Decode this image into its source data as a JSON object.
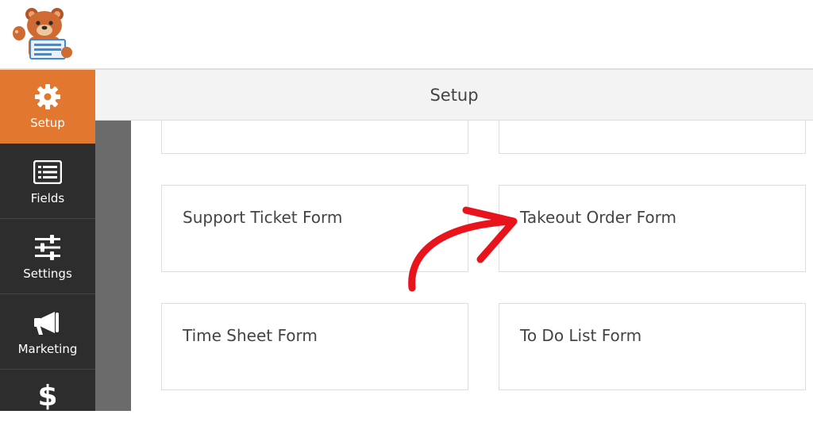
{
  "header": {
    "logo_icon": "wpforms-bear-mascot-icon",
    "setup_title": "Setup"
  },
  "sidebar": {
    "items": [
      {
        "label": "Setup",
        "icon": "gear-icon",
        "active": true
      },
      {
        "label": "Fields",
        "icon": "fields-list-icon",
        "active": false
      },
      {
        "label": "Settings",
        "icon": "sliders-icon",
        "active": false
      },
      {
        "label": "Marketing",
        "icon": "megaphone-icon",
        "active": false
      },
      {
        "label": "",
        "icon": "dollar-icon",
        "active": false
      }
    ]
  },
  "templates": {
    "cards": [
      {
        "title": ""
      },
      {
        "title": ""
      },
      {
        "title": "Support Ticket Form"
      },
      {
        "title": "Takeout Order Form"
      },
      {
        "title": "Time Sheet Form"
      },
      {
        "title": "To Do List Form"
      }
    ]
  },
  "annotation": {
    "arrow_icon": "red-curved-arrow-icon",
    "color": "#e8131b"
  },
  "colors": {
    "accent": "#e27730",
    "sidebar": "#2d2d2d",
    "gutter": "#6b6b6b"
  }
}
